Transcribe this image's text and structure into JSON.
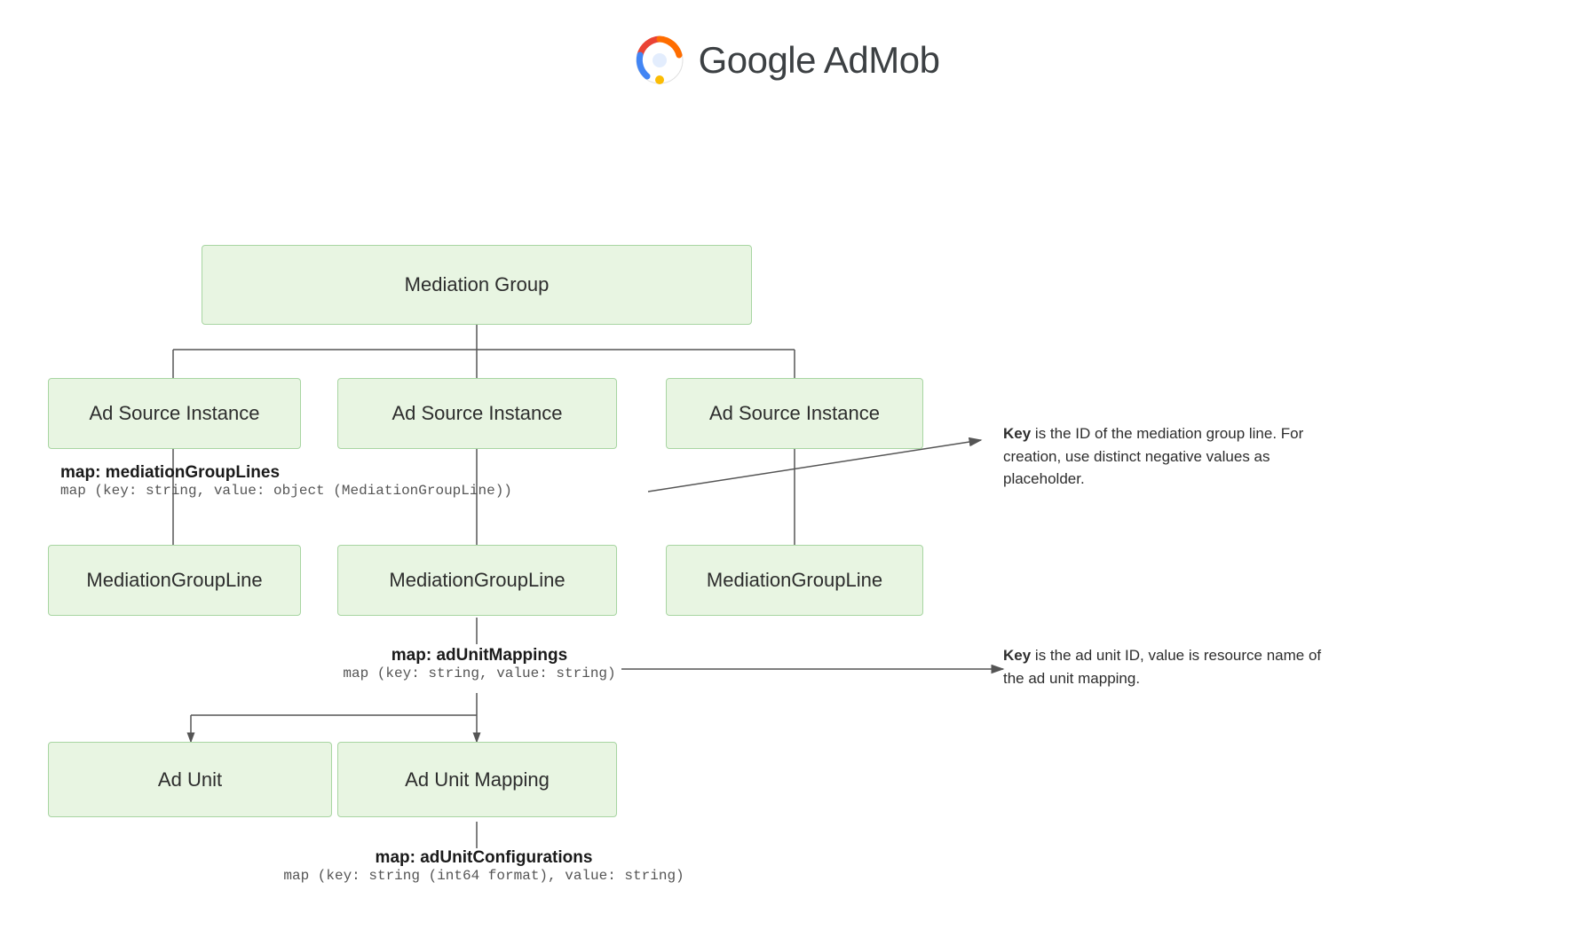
{
  "header": {
    "title": "Google AdMob"
  },
  "diagram": {
    "boxes": {
      "mediation_group": {
        "label": "Mediation Group"
      },
      "ad_source_1": {
        "label": "Ad Source Instance"
      },
      "ad_source_2": {
        "label": "Ad Source Instance"
      },
      "ad_source_3": {
        "label": "Ad Source Instance"
      },
      "mediation_line_1": {
        "label": "MediationGroupLine"
      },
      "mediation_line_2": {
        "label": "MediationGroupLine"
      },
      "mediation_line_3": {
        "label": "MediationGroupLine"
      },
      "ad_unit": {
        "label": "Ad Unit"
      },
      "ad_unit_mapping": {
        "label": "Ad Unit Mapping"
      }
    },
    "annotations": {
      "map1_line1": "map: mediationGroupLines",
      "map1_line2_pre": "map (key: string, value: object (",
      "map1_link": "MediationGroupLine",
      "map1_line2_post": "))",
      "annotation1_bold": "Key",
      "annotation1_text": " is the ID of the mediation group line. For creation, use distinct negative values as placeholder.",
      "map2_line1": "map: adUnitMappings",
      "map2_line2": "map (key: string, value: string)",
      "annotation2_bold": "Key",
      "annotation2_text": " is the ad unit ID, value is resource name of the ad unit mapping.",
      "map3_line1": "map: adUnitConfigurations",
      "map3_line2_pre": "map (key: string (",
      "map3_link": "int64",
      "map3_line2_post": " format), value: string)"
    }
  }
}
